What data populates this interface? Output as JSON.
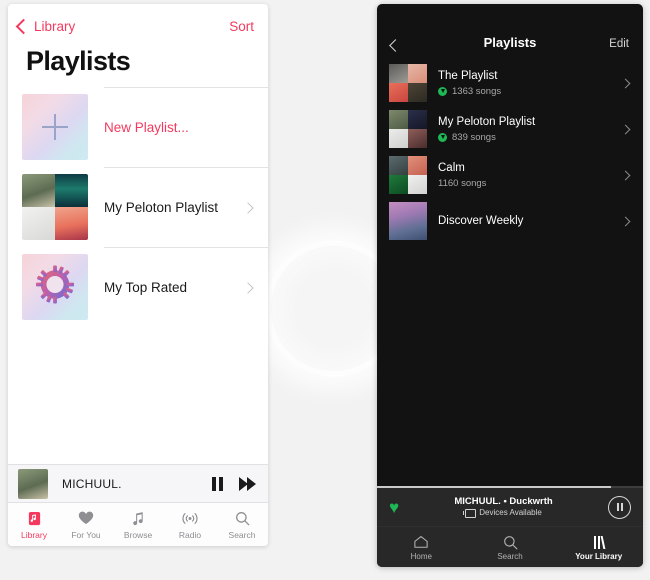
{
  "left_app": {
    "navbar": {
      "back_label": "Library",
      "sort_label": "Sort"
    },
    "page_title": "Playlists",
    "rows": [
      {
        "label": "New Playlist...",
        "art": "gradient-plus",
        "accent": true,
        "disclosure": false
      },
      {
        "label": "My Peloton Playlist",
        "art": "collage",
        "accent": false,
        "disclosure": true
      },
      {
        "label": "My Top Rated",
        "art": "gear",
        "accent": false,
        "disclosure": true
      }
    ],
    "player": {
      "track": "MICHUUL.",
      "pause_icon": "pause-icon",
      "next_icon": "next-track-icon"
    },
    "tabs": [
      {
        "label": "Library",
        "icon": "library-icon",
        "active": true
      },
      {
        "label": "For You",
        "icon": "heart-icon",
        "active": false
      },
      {
        "label": "Browse",
        "icon": "music-note-icon",
        "active": false
      },
      {
        "label": "Radio",
        "icon": "radio-waves-icon",
        "active": false
      },
      {
        "label": "Search",
        "icon": "search-icon",
        "active": false
      }
    ],
    "accent_color": "#f5395e"
  },
  "right_app": {
    "navbar": {
      "back_icon": "chevron-left-icon",
      "title": "Playlists",
      "edit_label": "Edit"
    },
    "rows": [
      {
        "name": "The Playlist",
        "count": "1363 songs",
        "downloaded": true,
        "art": "collage-a"
      },
      {
        "name": "My Peloton Playlist",
        "count": "839 songs",
        "downloaded": true,
        "art": "collage-b"
      },
      {
        "name": "Calm",
        "count": "1160 songs",
        "downloaded": false,
        "art": "collage-c"
      },
      {
        "name": "Discover Weekly",
        "count": "",
        "downloaded": false,
        "art": "discover"
      }
    ],
    "now_playing": {
      "title": "MICHUUL. • Duckwrth",
      "devices": "Devices Available",
      "heart_icon": "heart-icon",
      "pause_icon": "pause-circle-icon",
      "progress_percent": 88
    },
    "tabs": [
      {
        "label": "Home",
        "icon": "home-icon",
        "active": false
      },
      {
        "label": "Search",
        "icon": "search-icon",
        "active": false
      },
      {
        "label": "Your Library",
        "icon": "library-bars-icon",
        "active": true
      }
    ],
    "accent_color": "#1db954"
  }
}
